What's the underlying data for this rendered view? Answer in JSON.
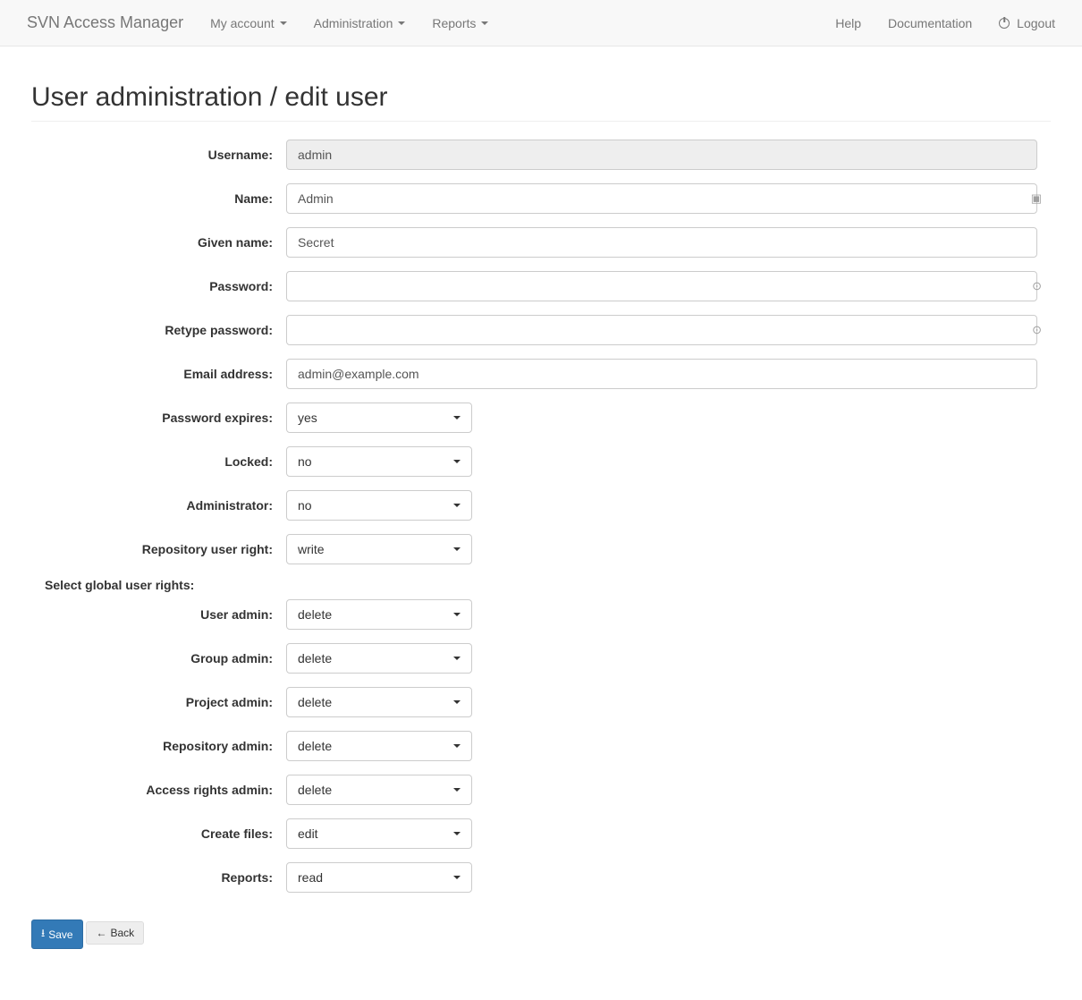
{
  "navbar": {
    "brand": "SVN Access Manager",
    "left": [
      {
        "label": "My account"
      },
      {
        "label": "Administration"
      },
      {
        "label": "Reports"
      }
    ],
    "right": {
      "help": "Help",
      "documentation": "Documentation",
      "logout": "Logout"
    }
  },
  "page_title": "User administration / edit user",
  "form": {
    "username_label": "Username:",
    "username_value": "admin",
    "name_label": "Name:",
    "name_value": "Admin",
    "givenname_label": "Given name:",
    "givenname_value": "Secret",
    "password_label": "Password:",
    "password_value": "",
    "retype_label": "Retype password:",
    "retype_value": "",
    "email_label": "Email address:",
    "email_value": "admin@example.com",
    "pwexpires_label": "Password expires:",
    "pwexpires_value": "yes",
    "locked_label": "Locked:",
    "locked_value": "no",
    "admin_label": "Administrator:",
    "admin_value": "no",
    "repouser_label": "Repository user right:",
    "repouser_value": "write",
    "global_heading": "Select global user rights:",
    "useradmin_label": "User admin:",
    "useradmin_value": "delete",
    "groupadmin_label": "Group admin:",
    "groupadmin_value": "delete",
    "projectadmin_label": "Project admin:",
    "projectadmin_value": "delete",
    "repoadmin_label": "Repository admin:",
    "repoadmin_value": "delete",
    "accessadmin_label": "Access rights admin:",
    "accessadmin_value": "delete",
    "createfiles_label": "Create files:",
    "createfiles_value": "edit",
    "reports_label": "Reports:",
    "reports_value": "read"
  },
  "buttons": {
    "save": "Save",
    "back": "Back"
  }
}
